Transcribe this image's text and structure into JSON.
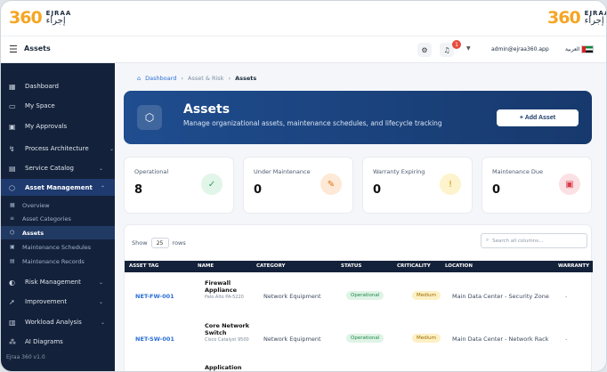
{
  "brand": {
    "num": "360",
    "en": "EJRAA",
    "ar": "إجراء"
  },
  "topbar": {
    "page_title": "Assets",
    "notif_count": "1",
    "user_email": "admin@ejraa360.app",
    "lang_label": "العربية"
  },
  "sidebar": {
    "items": [
      {
        "label": "Dashboard",
        "icon": "dashboard-icon"
      },
      {
        "label": "My Space",
        "icon": "folder-icon"
      },
      {
        "label": "My Approvals",
        "icon": "clipboard-icon"
      },
      {
        "label": "Process Architecture",
        "icon": "flow-icon"
      },
      {
        "label": "Service Catalog",
        "icon": "catalog-icon"
      },
      {
        "label": "Asset Management",
        "icon": "cube-icon"
      },
      {
        "label": "Risk Management",
        "icon": "shield-icon"
      },
      {
        "label": "Improvement",
        "icon": "rocket-icon"
      },
      {
        "label": "Workload Analysis",
        "icon": "chart-icon"
      },
      {
        "label": "AI Diagrams",
        "icon": "diagram-icon"
      }
    ],
    "sub": [
      {
        "label": "Overview"
      },
      {
        "label": "Asset Categories"
      },
      {
        "label": "Assets"
      },
      {
        "label": "Maintenance Schedules"
      },
      {
        "label": "Maintenance Records"
      }
    ],
    "version": "Ejraa 360 v1.0"
  },
  "breadcrumb": {
    "home": "Dashboard",
    "parent": "Asset & Risk",
    "current": "Assets"
  },
  "hero": {
    "title": "Assets",
    "subtitle": "Manage organizational assets, maintenance schedules, and lifecycle tracking",
    "add_label": "+ Add Asset"
  },
  "stats": [
    {
      "label": "Operational",
      "value": "8",
      "icon": "check-circle-icon",
      "color": "#2e9d57",
      "bg": "#e2f5e9"
    },
    {
      "label": "Under Maintenance",
      "value": "0",
      "icon": "wrench-icon",
      "color": "#e0741a",
      "bg": "#fde9d6"
    },
    {
      "label": "Warranty Expiring",
      "value": "0",
      "icon": "shield-alert-icon",
      "color": "#c99700",
      "bg": "#fdf3cc"
    },
    {
      "label": "Maintenance Due",
      "value": "0",
      "icon": "calendar-icon",
      "color": "#d93c4a",
      "bg": "#fbe1e3"
    }
  ],
  "table": {
    "show_label": "Show",
    "page_size": "25",
    "rows_label": "rows",
    "search_placeholder": "Search all columns...",
    "headers": [
      "ASSET TAG",
      "NAME",
      "CATEGORY",
      "STATUS",
      "CRITICALITY",
      "LOCATION",
      "WARRANTY"
    ],
    "rows": [
      {
        "tag": "NET-FW-001",
        "name": "Firewall Appliance",
        "sub": "Palo Alto PA-5220",
        "category": "Network Equipment",
        "status": "Operational",
        "criticality": "Medium",
        "location": "Main Data Center - Security Zone",
        "warranty": "-"
      },
      {
        "tag": "NET-SW-001",
        "name": "Core Network Switch",
        "sub": "Cisco Catalyst 9500",
        "category": "Network Equipment",
        "status": "Operational",
        "criticality": "Medium",
        "location": "Main Data Center - Network Rack",
        "warranty": "-"
      },
      {
        "name": "Application"
      }
    ]
  }
}
